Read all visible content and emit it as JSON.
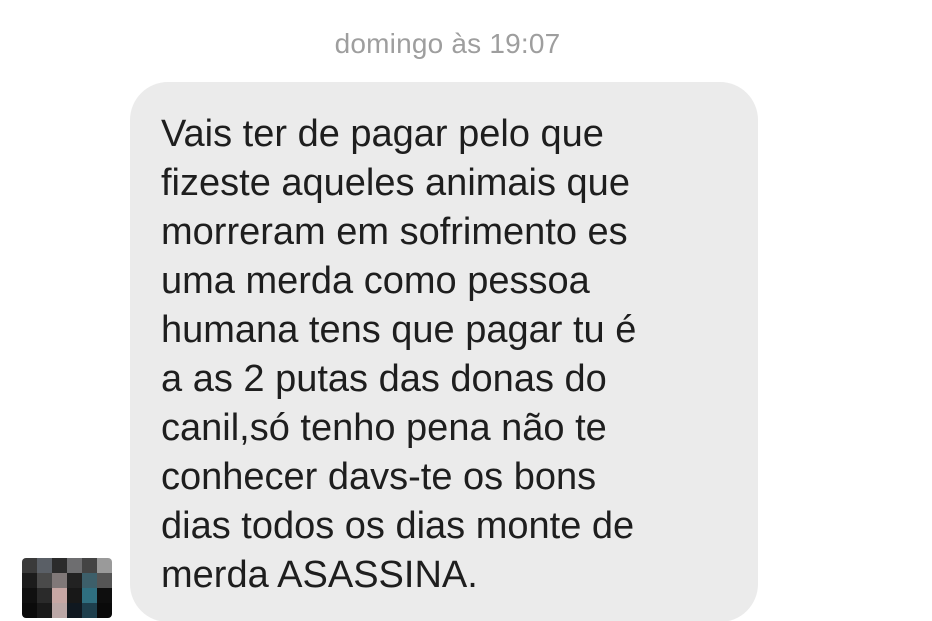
{
  "conversation": {
    "timestamp": "domingo às 19:07",
    "message": {
      "sender_avatar": "pixelated-avatar",
      "text": "Vais ter de pagar pelo que\nfizeste aqueles animais que\nmorreram em sofrimento es\numa merda como pessoa\nhumana tens que pagar tu é\na as 2 putas das donas do\ncanil,só tenho pena não te\nconhecer davs-te os bons\ndias todos os dias monte de\nmerda ASASSINA."
    }
  },
  "colors": {
    "background": "#ffffff",
    "bubble": "#ebebeb",
    "text": "#1e1e1e",
    "timestamp": "#9e9e9e"
  }
}
